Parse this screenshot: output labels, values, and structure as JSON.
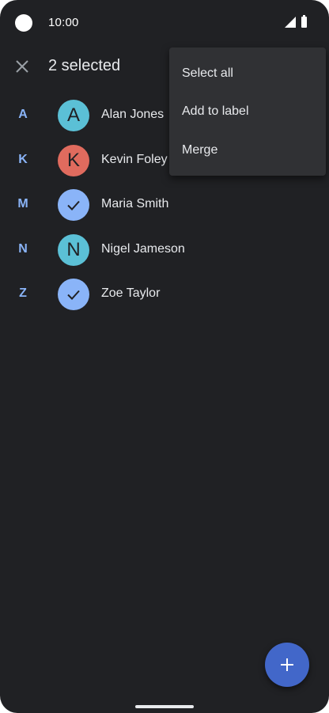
{
  "status_bar": {
    "time": "10:00",
    "icons": [
      "signal-icon",
      "battery-icon"
    ]
  },
  "app_bar": {
    "title": "2 selected",
    "close_icon": "close-icon"
  },
  "contacts": [
    {
      "letter": "A",
      "name": "Alan Jones",
      "initial": "A",
      "avatar_color": "#5bc0d6",
      "selected": false
    },
    {
      "letter": "K",
      "name": "Kevin Foley",
      "initial": "K",
      "avatar_color": "#e06b5e",
      "selected": false
    },
    {
      "letter": "M",
      "name": "Maria Smith",
      "initial": "",
      "avatar_color": "#8ab4f8",
      "selected": true
    },
    {
      "letter": "N",
      "name": "Nigel Jameson",
      "initial": "N",
      "avatar_color": "#5bc0d6",
      "selected": false
    },
    {
      "letter": "Z",
      "name": "Zoe Taylor",
      "initial": "",
      "avatar_color": "#8ab4f8",
      "selected": true
    }
  ],
  "overflow_menu": {
    "items": [
      "Select all",
      "Add to label",
      "Merge"
    ]
  },
  "fab": {
    "icon": "plus-icon"
  },
  "colors": {
    "background": "#202124",
    "accent": "#8ab4f8",
    "menu_background": "#303134",
    "fab_background": "#4267c9"
  }
}
